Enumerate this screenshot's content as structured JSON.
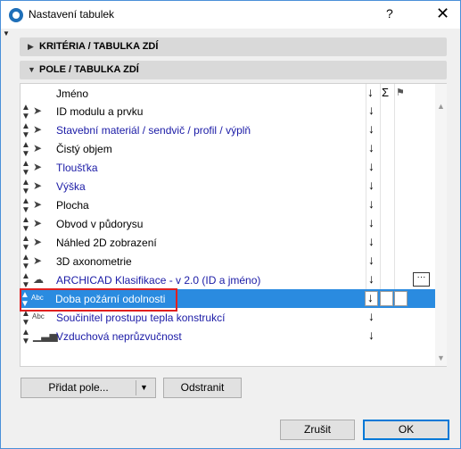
{
  "window": {
    "title": "Nastavení tabulek",
    "help": "?",
    "close": "✕"
  },
  "sections": [
    {
      "label": "KRITÉRIA /  TABULKA ZDÍ",
      "state": "collapsed"
    },
    {
      "label": "POLE /  TABULKA ZDÍ",
      "state": "expanded"
    }
  ],
  "table": {
    "header": {
      "name": "Jméno",
      "sort": "↓",
      "sum": "Σ",
      "flag": "⚑"
    },
    "rows": [
      {
        "name": "ID modulu a prvku",
        "icon": "cursor-icon",
        "color": "#000000",
        "sort": "↓"
      },
      {
        "name": "Stavební materiál / sendvič / profil / výplň",
        "icon": "cursor-icon",
        "color": "#1a1aa6",
        "sort": "↓"
      },
      {
        "name": "Čistý objem",
        "icon": "cursor-icon",
        "color": "#000000",
        "sort": "↓"
      },
      {
        "name": "Tloušťka",
        "icon": "cursor-icon",
        "color": "#1a1aa6",
        "sort": "↓"
      },
      {
        "name": "Výška",
        "icon": "cursor-icon",
        "color": "#1a1aa6",
        "sort": "↓"
      },
      {
        "name": "Plocha",
        "icon": "cursor-icon",
        "color": "#000000",
        "sort": "↓"
      },
      {
        "name": "Obvod v půdorysu",
        "icon": "cursor-icon",
        "color": "#000000",
        "sort": "↓"
      },
      {
        "name": "Náhled 2D zobrazení",
        "icon": "cursor-icon",
        "color": "#000000",
        "sort": "↓"
      },
      {
        "name": "3D axonometrie",
        "icon": "cursor-icon",
        "color": "#000000",
        "sort": "↓"
      },
      {
        "name": "ARCHICAD Klasifikace - v 2.0 (ID a jméno)",
        "icon": "classification-icon",
        "color": "#1a1aa6",
        "sort": "↓",
        "more": "···"
      },
      {
        "name": "Doba požární odolnosti",
        "icon": "abc-icon",
        "icon_text": "Abc",
        "color": "#ffffff",
        "sort": "↓",
        "selected": true
      },
      {
        "name": "Součinitel prostupu tepla konstrukcí",
        "icon": "abc-icon",
        "icon_text": "Abc",
        "color": "#1a1aa6",
        "sort": "↓"
      },
      {
        "name": "Vzduchová neprůzvučnost",
        "icon": "bars-icon",
        "color": "#1a1aa6",
        "sort": "↓"
      }
    ]
  },
  "buttons": {
    "add_field": "Přidat pole...",
    "remove": "Odstranit",
    "cancel": "Zrušit",
    "ok": "OK"
  }
}
